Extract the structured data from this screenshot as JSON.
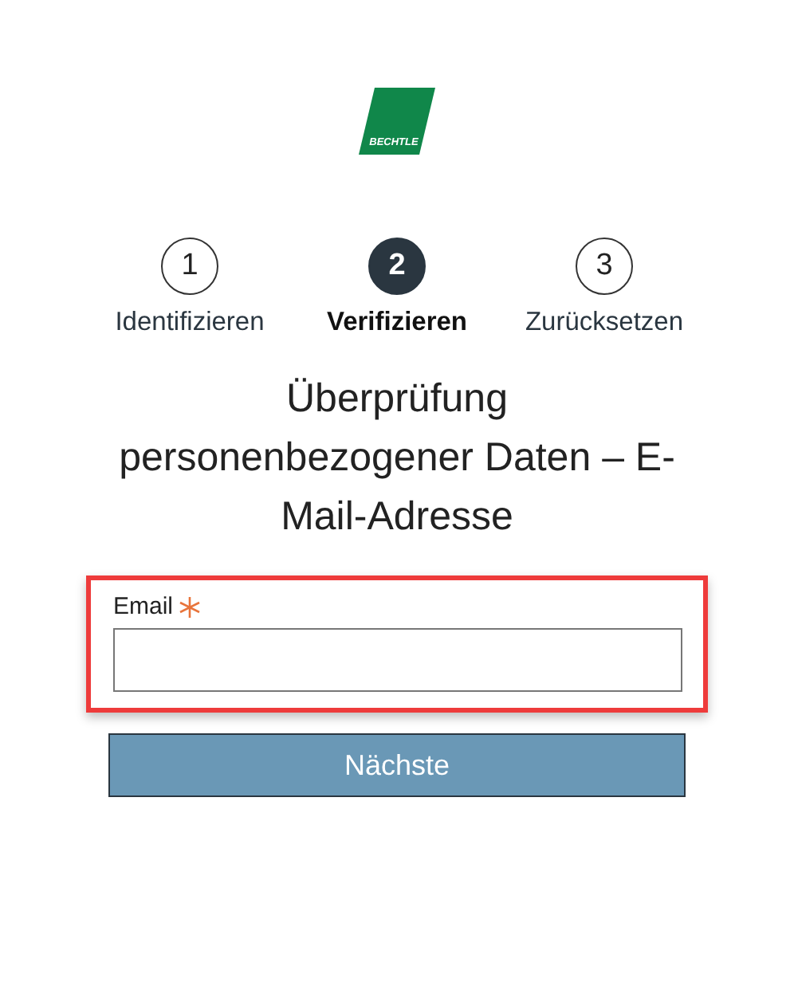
{
  "logo": {
    "text": "BECHTLE"
  },
  "steps": [
    {
      "number": "1",
      "label": "Identifizieren",
      "selected": false
    },
    {
      "number": "2",
      "label": "Verifizieren",
      "selected": true
    },
    {
      "number": "3",
      "label": "Zurücksetzen",
      "selected": false
    }
  ],
  "title": "Überprüfung personenbezogener Daten – E-Mail-Adresse",
  "email_field": {
    "label": "Email",
    "required": true,
    "highlighted": true
  },
  "next_button": {
    "label": "Nächste"
  }
}
